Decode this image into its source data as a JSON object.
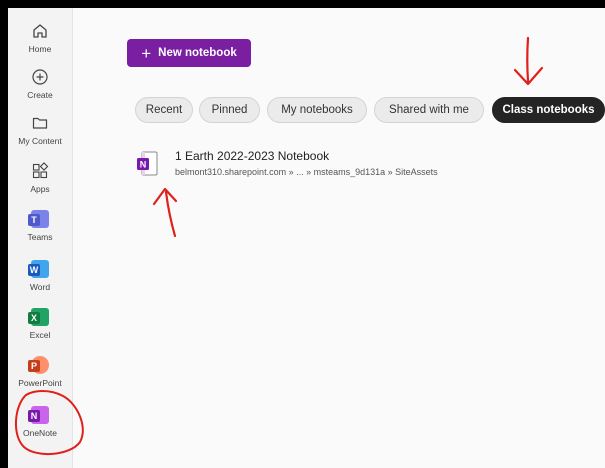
{
  "sidebar": {
    "items": [
      {
        "label": "Home",
        "icon": "home-icon"
      },
      {
        "label": "Create",
        "icon": "plus-circle-icon"
      },
      {
        "label": "My Content",
        "icon": "folder-icon"
      },
      {
        "label": "Apps",
        "icon": "apps-icon"
      },
      {
        "label": "Teams",
        "icon": "teams-icon"
      },
      {
        "label": "Word",
        "icon": "word-icon"
      },
      {
        "label": "Excel",
        "icon": "excel-icon"
      },
      {
        "label": "PowerPoint",
        "icon": "powerpoint-icon"
      },
      {
        "label": "OneNote",
        "icon": "onenote-icon"
      }
    ]
  },
  "toolbar": {
    "new_notebook_label": "New notebook"
  },
  "filters": {
    "pills": [
      "Recent",
      "Pinned",
      "My notebooks",
      "Shared with me",
      "Class notebooks"
    ],
    "selected": "Class notebooks"
  },
  "notebooks": [
    {
      "title": "1 Earth 2022-2023 Notebook",
      "path": "belmont310.sharepoint.com » ... » msteams_9d131a » SiteAssets",
      "icon": "onenote-notebook-icon"
    }
  ],
  "colors": {
    "accent": "#7b1fa2",
    "onenote": "#7719aa",
    "word": "#185abd",
    "excel": "#107c41",
    "powerpoint": "#c43e1c",
    "teams": "#5059c9",
    "annotation": "#e0201b"
  }
}
